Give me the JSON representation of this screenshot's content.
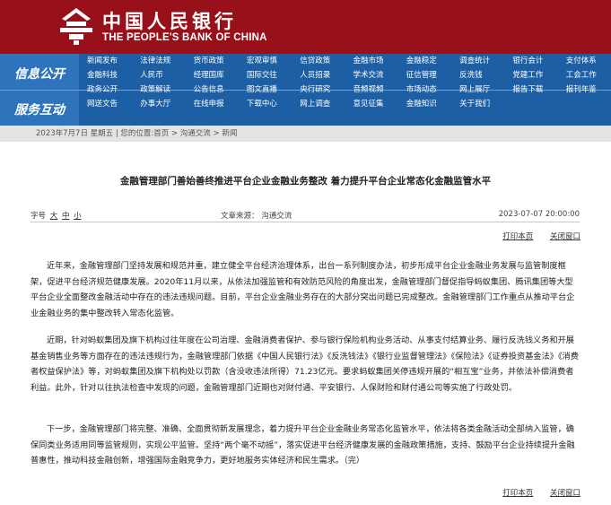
{
  "header": {
    "cn_name": "中国人民银行",
    "en_name": "THE PEOPLE'S BANK OF CHINA"
  },
  "nav": {
    "side_labels": [
      "信息公开",
      "服务互动"
    ],
    "rows": [
      [
        "新闻发布",
        "法律法规",
        "货币政策",
        "宏观审慎",
        "信贷政策",
        "金融市场",
        "金融稳定",
        "调查统计",
        "银行会计",
        "支付体系"
      ],
      [
        "金融科技",
        "人民币",
        "经理国库",
        "国际交往",
        "人员招录",
        "学术交流",
        "征信管理",
        "反洗钱",
        "党建工作",
        "工会工作"
      ],
      [
        "政务公开",
        "政策解读",
        "公告信息",
        "图文直播",
        "央行研究",
        "音频视频",
        "市场动态",
        "网上展厅",
        "报告下载",
        "报刊年鉴"
      ],
      [
        "网送文告",
        "办事大厅",
        "在线申报",
        "下载中心",
        "网上调查",
        "意见征集",
        "金融知识",
        "关于我们"
      ]
    ]
  },
  "breadcrumb": "2023年7月7日 星期五 | 您的位置:首页 > 沟通交流 > 新闻",
  "article": {
    "title": "金融管理部门善始善终推进平台企业金融业务整改 着力提升平台企业常态化金融监管水平",
    "font_label": "字号",
    "font_sizes": [
      "大",
      "中",
      "小"
    ],
    "source": "文章来源：  沟通交流",
    "date": "2023-07-07 20:00:00",
    "print_label": "打印本页",
    "close_label": "关闭窗口",
    "paragraphs": [
      "近年来，金融管理部门坚持发展和规范并重，建立健全平台经济治理体系，出台一系列制度办法，初步形成平台企业金融业务发展与监管制度框架，促进平台经济规范健康发展。2020年11月以来，从依法加强监管和有效防范风险的角度出发，金融管理部门督促指导蚂蚁集团、腾讯集团等大型平台企业全面整改金融活动中存在的违法违规问题。目前，平台企业金融业务存在的大部分突出问题已完成整改。金融管理部门工作重点从推动平台企业金融业务的集中整改转入常态化监管。",
      "近期，针对蚂蚁集团及旗下机构过往年度在公司治理、金融消费者保护、参与银行保险机构业务活动、从事支付结算业务、履行反洗钱义务和开展基金销售业务等方面存在的违法违规行为，金融管理部门依据《中国人民银行法》《反洗钱法》《银行业监督管理法》《保险法》《证券投资基金法》《消费者权益保护法》等，对蚂蚁集团及旗下机构处以罚款（含没收违法所得）71.23亿元。要求蚂蚁集团关停违规开展的“相互宝”业务，并依法补偿消费者利益。此外，针对以往执法检查中发现的问题，金融管理部门近期也对财付通、平安银行、人保财险和财付通公司等实施了行政处罚。",
      "下一步，金融管理部门将完整、准确、全面贯彻新发展理念，着力提升平台企业金融业务常态化监管水平，依法将各类金融活动全部纳入监管，确保同类业务适用同等监管规则，实现公平监管。坚持“两个毫不动摇”，落实促进平台经济健康发展的金融政策措施，支持、鼓励平台企业持续提升金融普惠性，推动科技金融创新，增强国际金融竞争力，更好地服务实体经济和民生需求。（完）"
    ]
  },
  "colors": {
    "header_red": "#98111a",
    "nav_blue": "#1d5fa4",
    "nav_side_blue": "#2e74bd",
    "breadcrumb_gray": "#e4e4e4"
  },
  "icons": [
    "pboc-emblem-icon"
  ]
}
